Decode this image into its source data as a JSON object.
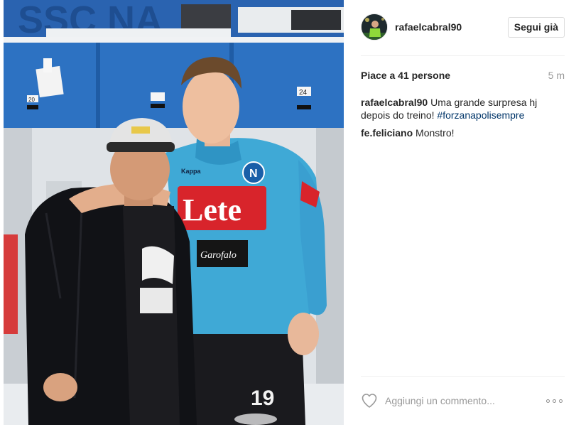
{
  "photo": {
    "alt": "Post photo",
    "wall_banner_text": "SSC NA",
    "shirt_sponsor": "Lete",
    "shirt_secondary_sponsor": "Garofalo",
    "shirt_brand": "Kappa",
    "shorts_number": "19",
    "locker_numbers": [
      "20",
      "24"
    ]
  },
  "header": {
    "username": "rafaelcabral90",
    "follow_label": "Segui già"
  },
  "stats": {
    "likes": "Piace a 41 persone",
    "time": "5 m"
  },
  "comments": [
    {
      "user": "rafaelcabral90",
      "text": "Uma grande surpresa hj depois do treino!",
      "hashtag": "#forzanapolisempre"
    },
    {
      "user": "fe.feliciano",
      "text": "Monstro!",
      "hashtag": ""
    }
  ],
  "footer": {
    "comment_placeholder": "Aggiungi un commento...",
    "like_icon": "heart-outline-icon",
    "more_icon": "more-options-icon"
  },
  "colors": {
    "accent_text": "#262626",
    "muted_text": "#999999",
    "hashtag": "#003569",
    "napoli_blue": "#3fa9d6",
    "wall_blue": "#2a6fbe"
  }
}
